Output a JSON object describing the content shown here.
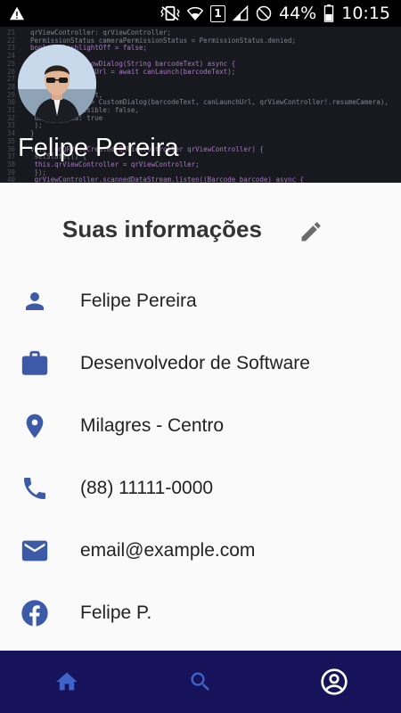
{
  "status_bar": {
    "battery_percent": "44%",
    "time": "10:15",
    "sim_label": "1",
    "icons": [
      "warning-icon",
      "vibrate-icon",
      "wifi-icon",
      "sim-icon",
      "signal-icon",
      "dnd-icon",
      "battery-icon"
    ]
  },
  "header": {
    "profile_name": "Felipe Pereira",
    "code_lines": [
      "qrViewController: qrViewController;",
      "PermissionStatus cameraPermissionStatus = PermissionStatus.denied;",
      "bool isFlashlightOff = false;",
      "",
      "Future<void> showDialog(String barcodeText) async {",
      "  final canLaunchUrl = await canLaunch(barcodeText);",
      "",
      "  showDialog(",
      "    context: context,",
      "    builder: (_) => CustomDialog(barcodeText, canLaunchUrl, qrViewController!.resumeCamera),",
      "    barrierDismissible: false,",
      "    useSafeArea: true",
      "  );",
      "}",
      "",
      "void _onQRViewCreated(QRViewController qrViewController) {",
      "  setState(() {",
      "    this.qrViewController = qrViewController;",
      "  });",
      "  qrViewController.scannedDataStream.listen((Barcode barcode) async {"
    ]
  },
  "info": {
    "title": "Suas informações",
    "items": [
      {
        "icon": "person-icon",
        "text": "Felipe Pereira"
      },
      {
        "icon": "briefcase-icon",
        "text": "Desenvolvedor de Software"
      },
      {
        "icon": "location-pin-icon",
        "text": "Milagres - Centro"
      },
      {
        "icon": "phone-icon",
        "text": "(88) 11111-0000"
      },
      {
        "icon": "email-icon",
        "text": "email@example.com"
      },
      {
        "icon": "facebook-icon",
        "text": "Felipe P."
      }
    ]
  },
  "bottom_nav": {
    "items": [
      {
        "icon": "home-icon",
        "active": false
      },
      {
        "icon": "search-icon",
        "active": false
      },
      {
        "icon": "account-circle-icon",
        "active": true
      }
    ]
  },
  "colors": {
    "accent_icon": "#3c5aa8",
    "nav_background": "#16135a",
    "nav_icon": "#3f63c8",
    "nav_icon_active": "#ffffff",
    "header_background": "#1e1f26"
  }
}
